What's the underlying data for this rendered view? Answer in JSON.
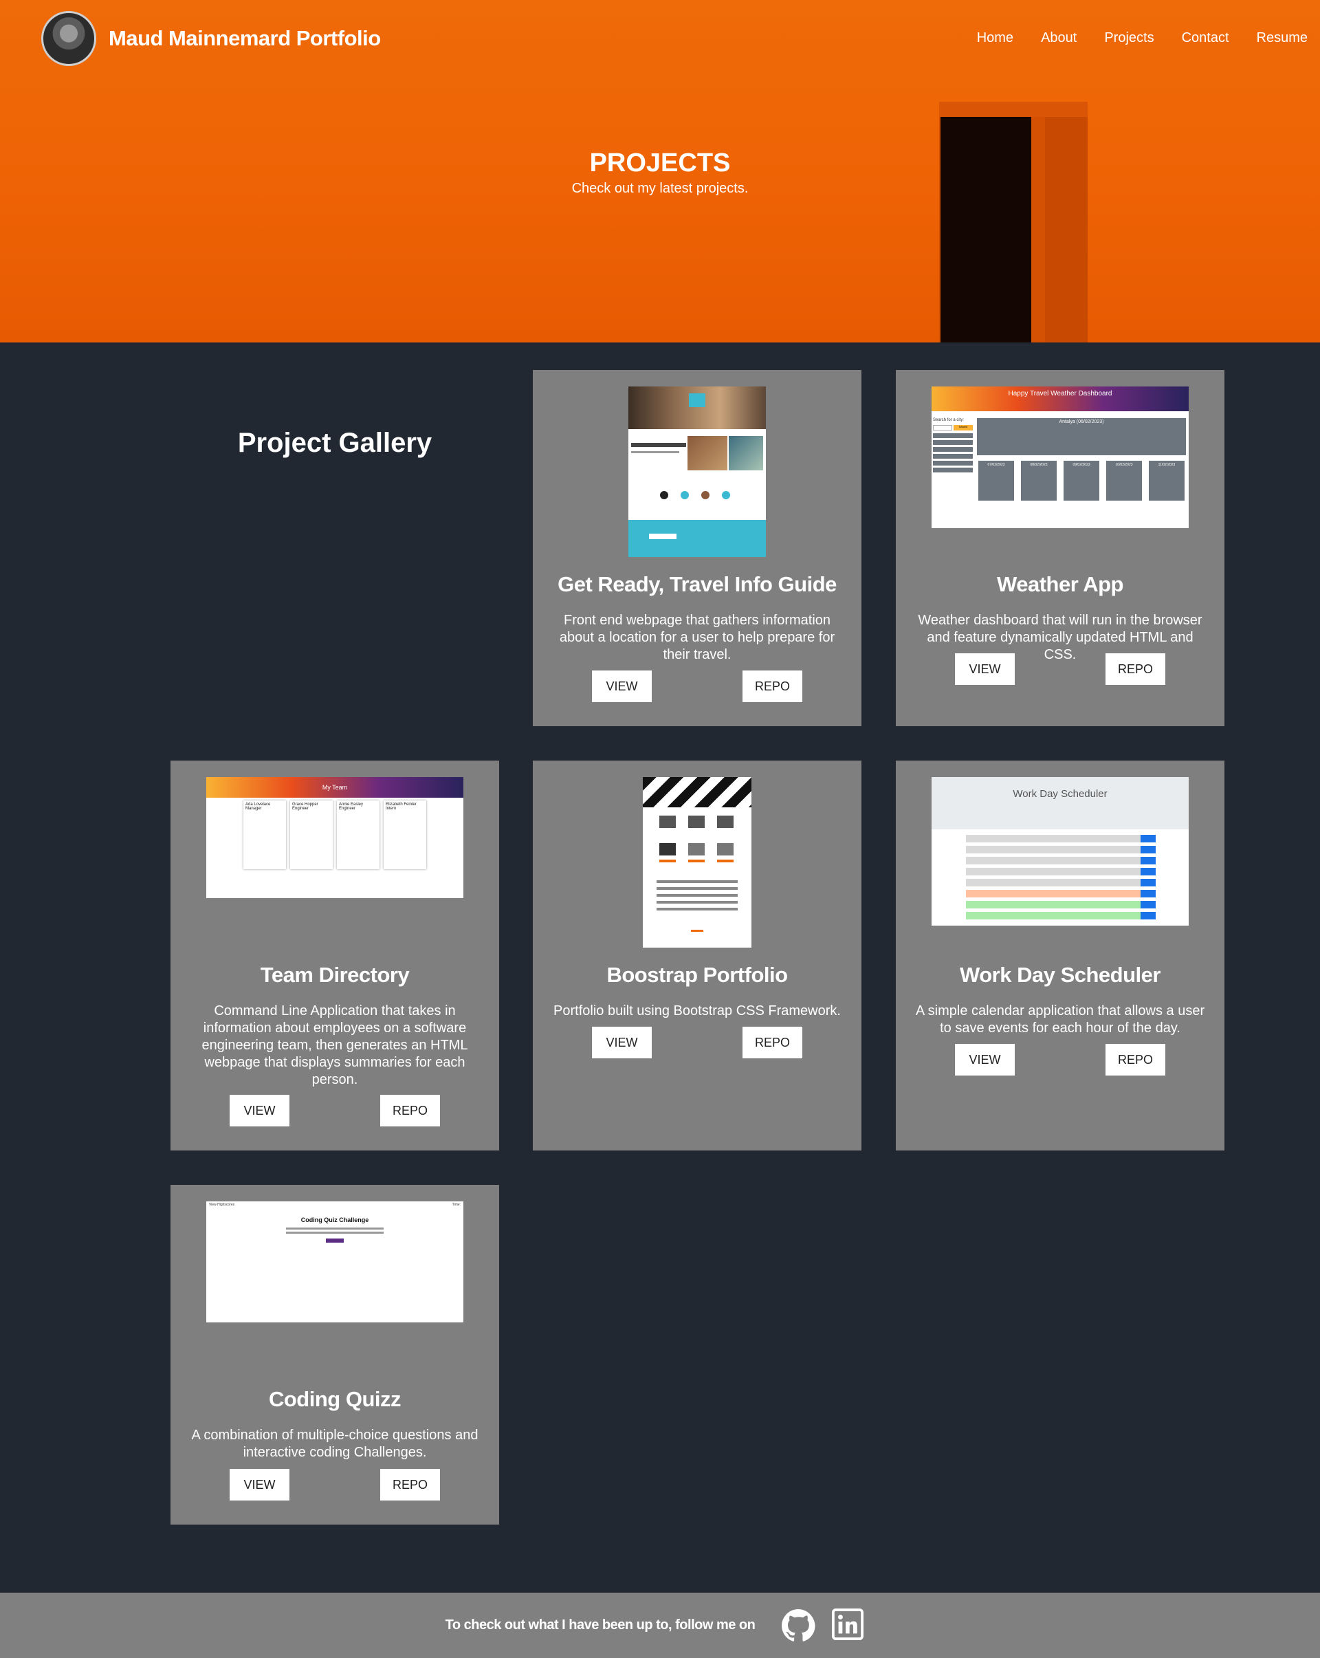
{
  "header": {
    "brand": "Maud Mainnemard Portfolio",
    "nav": [
      "Home",
      "About",
      "Projects",
      "Contact",
      "Resume"
    ]
  },
  "hero": {
    "title": "PROJECTS",
    "subtitle": "Check out my latest projects."
  },
  "gallery": {
    "title": "Project Gallery",
    "projects": [
      {
        "title": "Get Ready, Travel Info Guide",
        "description": "Front end webpage that gathers information about a location for a user to help prepare for their travel.",
        "view": "VIEW",
        "repo": "REPO"
      },
      {
        "title": "Weather App",
        "description": "Weather dashboard that will run in the browser and feature dynamically updated HTML and CSS.",
        "view": "VIEW",
        "repo": "REPO",
        "shot": {
          "heading": "Happy Travel Weather Dashboard",
          "city": "Antalya (06/02/2023)",
          "search": "Search for a city:",
          "search_btn": "Search",
          "days": [
            "07/02/2023",
            "08/02/2023",
            "09/02/2023",
            "10/02/2023",
            "11/02/2023"
          ]
        }
      },
      {
        "title": "Team Directory",
        "description": "Command Line Application that takes in information about employees on a software engineering team, then generates an HTML webpage that displays summaries for each person.",
        "view": "VIEW",
        "repo": "REPO",
        "shot": {
          "heading": "My Team",
          "members": [
            {
              "name": "Ada Lovelace",
              "role": "Manager"
            },
            {
              "name": "Grace Hopper",
              "role": "Engineer"
            },
            {
              "name": "Annie Easley",
              "role": "Engineer"
            },
            {
              "name": "Elizabeth Feinler",
              "role": "Intern"
            }
          ]
        }
      },
      {
        "title": "Boostrap Portfolio",
        "description": "Portfolio built using Bootstrap CSS Framework.",
        "view": "VIEW",
        "repo": "REPO"
      },
      {
        "title": "Work Day Scheduler",
        "description": "A simple calendar application that allows a user to save events for each hour of the day.",
        "view": "VIEW",
        "repo": "REPO",
        "shot": {
          "heading": "Work Day Scheduler"
        }
      },
      {
        "title": "Coding Quizz",
        "description": "A combination of multiple-choice questions and interactive coding Challenges.",
        "view": "VIEW",
        "repo": "REPO",
        "shot": {
          "heading": "Coding Quiz Challenge",
          "view_scores": "View Highscores",
          "time": "Time:"
        }
      }
    ]
  },
  "footer": {
    "text": "To check out what I have been up to, follow me on",
    "links": [
      "github-icon",
      "linkedin-icon"
    ]
  },
  "colors": {
    "hero": "#ee6305",
    "page_bg": "#222831",
    "card_bg": "#7f7f7f",
    "footer_bg": "#808080"
  }
}
